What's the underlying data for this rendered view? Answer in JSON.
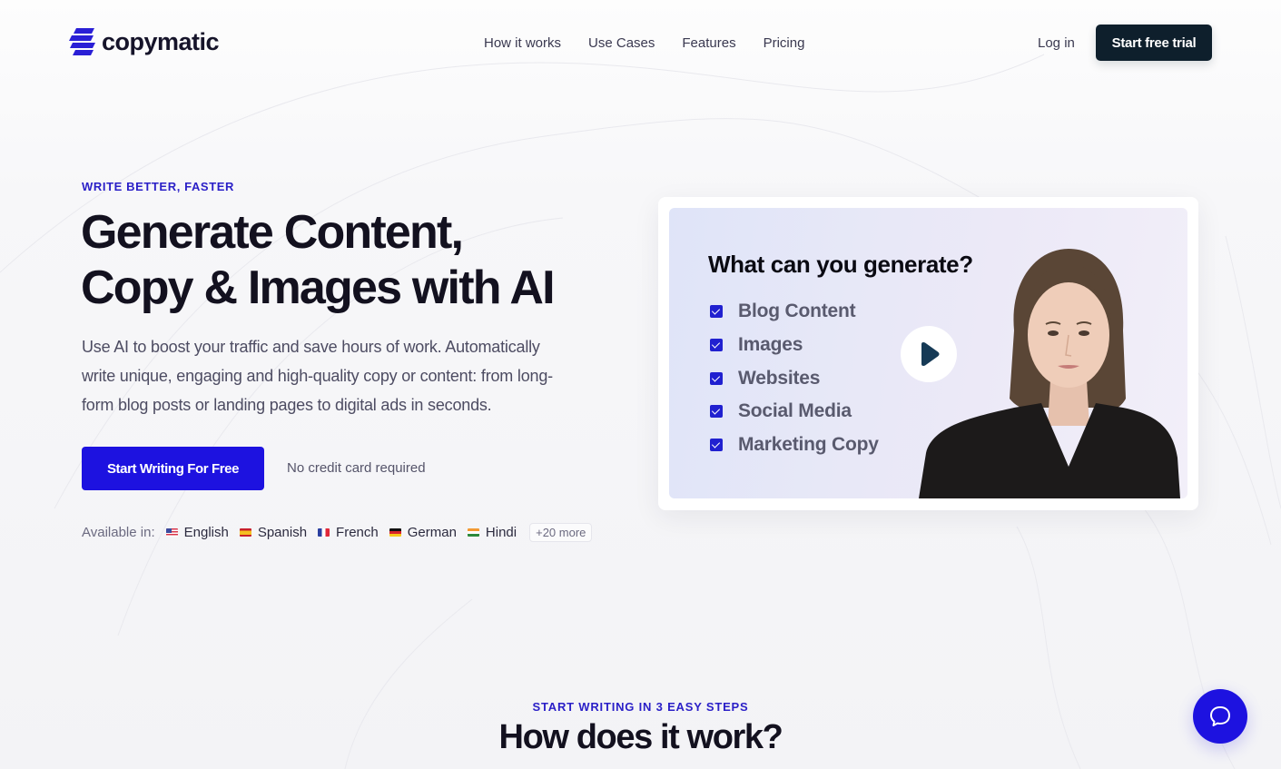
{
  "brand": {
    "name": "copymatic",
    "accent_color": "#1d12e0",
    "dark_color": "#0e1f2c"
  },
  "nav": {
    "items": [
      {
        "label": "How it works"
      },
      {
        "label": "Use Cases"
      },
      {
        "label": "Features"
      },
      {
        "label": "Pricing"
      }
    ],
    "login_label": "Log in",
    "trial_label": "Start free trial"
  },
  "hero": {
    "eyebrow": "WRITE BETTER, FASTER",
    "title_line1": "Generate Content,",
    "title_line2": "Copy & Images with AI",
    "description": "Use AI to boost your traffic and save hours of work. Automatically write unique, engaging and high-quality copy or content: from long-form blog posts or landing pages to digital ads in seconds.",
    "cta_label": "Start Writing For Free",
    "cta_note": "No credit card required",
    "languages_label": "Available in:",
    "languages": [
      {
        "name": "English",
        "flag": "us-flag"
      },
      {
        "name": "Spanish",
        "flag": "es-flag"
      },
      {
        "name": "French",
        "flag": "fr-flag"
      },
      {
        "name": "German",
        "flag": "de-flag"
      },
      {
        "name": "Hindi",
        "flag": "in-flag"
      }
    ],
    "more_languages": "+20 more"
  },
  "video": {
    "title": "What can you generate?",
    "items": [
      {
        "label": "Blog Content",
        "checked": true
      },
      {
        "label": "Images",
        "checked": true
      },
      {
        "label": "Websites",
        "checked": true
      },
      {
        "label": "Social Media",
        "checked": true
      },
      {
        "label": "Marketing Copy",
        "checked": true
      }
    ],
    "play_icon": "play-icon"
  },
  "how_it_works": {
    "eyebrow": "START WRITING IN 3 EASY STEPS",
    "title": "How does it work?"
  },
  "chat": {
    "icon": "chat-bubble-icon"
  }
}
